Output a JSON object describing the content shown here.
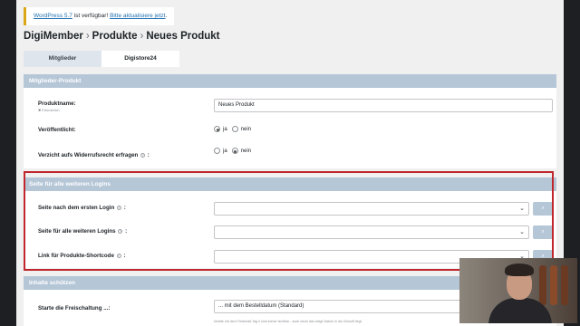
{
  "notice": {
    "version_text": "WordPress 5.7",
    "mid_text": " ist verfügbar! ",
    "link_text": "Bitte aktualisiere jetzt",
    "end": "."
  },
  "breadcrumb": {
    "part1": "DigiMember",
    "sep": "›",
    "part2": "Produkte",
    "part3": "Neues Produkt"
  },
  "tabs": [
    {
      "label": "Mitglieder"
    },
    {
      "label": "Digistore24"
    }
  ],
  "panel1": {
    "title": "Mitglieder-Produkt",
    "rows": [
      {
        "label": "Produktname:",
        "sub": "✱ Erforderlich",
        "value": "Neues Produkt"
      },
      {
        "label": "Veröffentlicht:",
        "opt_yes": "ja",
        "opt_no": "nein"
      },
      {
        "label": "Verzicht aufs Widerrufsrecht erfragen",
        "suffix": ":",
        "opt_yes": "ja",
        "opt_no": "nein"
      }
    ]
  },
  "panel2": {
    "title": "Seite für alle weiteren Logins",
    "rows": [
      {
        "label": "Seite nach dem ersten Login",
        "suffix": ":"
      },
      {
        "label": "Seite für alle weiteren Logins",
        "suffix": ":"
      },
      {
        "label": "Link für Produkte-Shortcode",
        "suffix": ":"
      }
    ]
  },
  "panel3": {
    "title": "Inhalte schützen",
    "row": {
      "label": "Starte die Freischaltung ...:",
      "value": "... mit dem Bestelldatum (Standard)",
      "hint": "Inhalte mit dem Freischalt-Tag 0 sind immer sichtbar - auch wenn das obige Datum in der Zukunft liegt."
    }
  },
  "icons": {
    "help": "?",
    "search": "⌕",
    "chevron": "⌄"
  },
  "colors": {
    "accent": "#b5c6d7",
    "highlight": "#c0262c",
    "notice_border": "#dba617",
    "link": "#2271b1"
  }
}
